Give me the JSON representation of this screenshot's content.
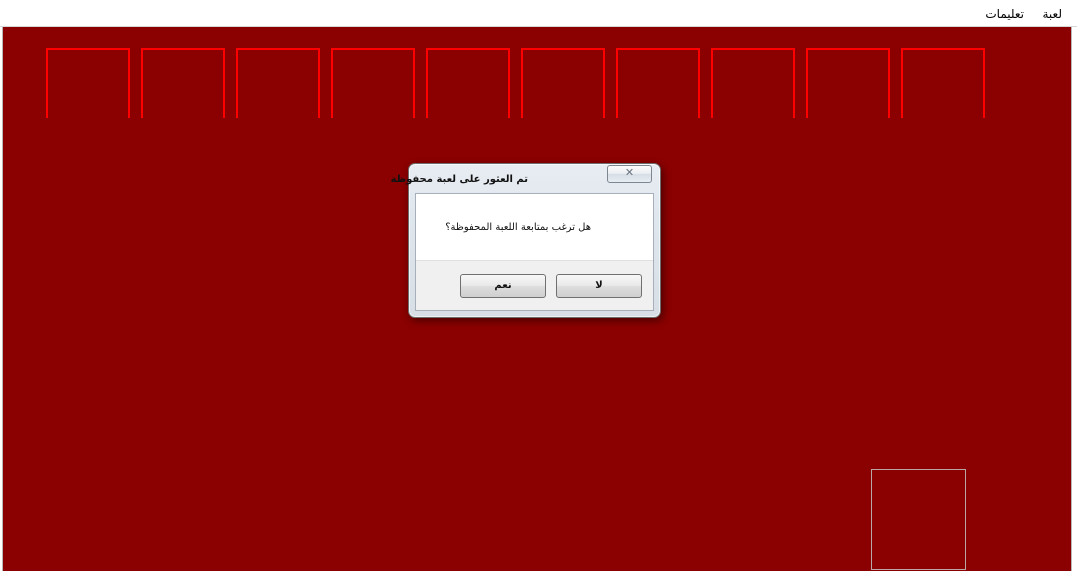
{
  "menu": {
    "game_label": "لعبة",
    "instructions_label": "تعليمات"
  },
  "dialog": {
    "title": "تم العثور على لعبة محفوظة",
    "message": "هل ترغب بمتابعة اللعبة المحفوظة؟",
    "yes_label": "نعم",
    "no_label": "لا",
    "close_glyph": "✕"
  },
  "colors": {
    "board_background": "#8b0000",
    "slot_outline": "#ff0000",
    "stock_outline": "#b9a6a6"
  },
  "board": {
    "foundation_slot_count": 10
  }
}
